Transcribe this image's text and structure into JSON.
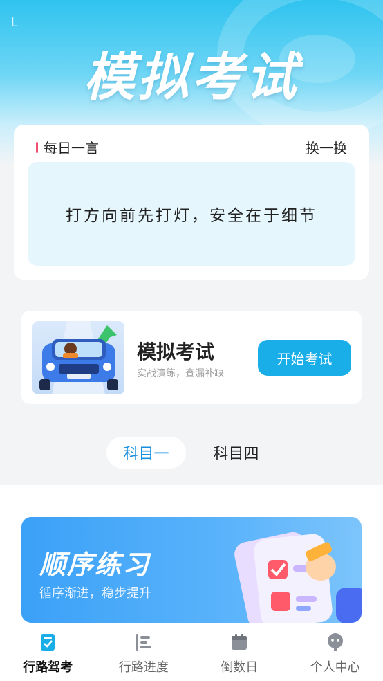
{
  "status": {
    "indicator": "L"
  },
  "header": {
    "title": "模拟考试"
  },
  "daily_quote": {
    "label": "每日一言",
    "switch_label": "换一换",
    "text": "打方向前先打灯，安全在于细节"
  },
  "exam_card": {
    "title": "模拟考试",
    "subtitle": "实战演练，查漏补缺",
    "button_label": "开始考试"
  },
  "subject_tabs": [
    {
      "label": "科目一",
      "active": true
    },
    {
      "label": "科目四",
      "active": false
    }
  ],
  "practice_card": {
    "title": "顺序练习",
    "subtitle": "循序渐进，稳步提升"
  },
  "bottom_nav": [
    {
      "label": "行路驾考",
      "icon": "exam-doc-icon",
      "active": true
    },
    {
      "label": "行路进度",
      "icon": "progress-chart-icon",
      "active": false
    },
    {
      "label": "倒数日",
      "icon": "calendar-icon",
      "active": false
    },
    {
      "label": "个人中心",
      "icon": "user-avatar-icon",
      "active": false
    }
  ],
  "colors": {
    "accent": "#1aaee9",
    "tab_active_text": "#1a8fe0",
    "quote_bar": "#f0506e"
  }
}
